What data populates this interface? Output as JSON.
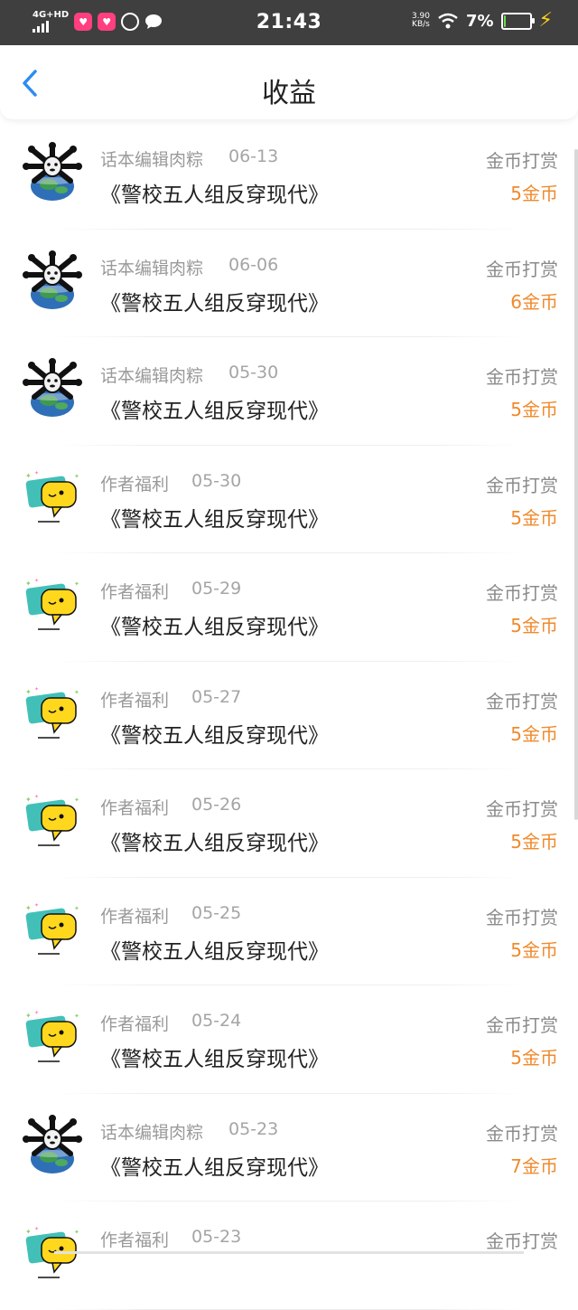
{
  "status_bar": {
    "network": "4G+HD",
    "time": "21:43",
    "speed_value": "3.90",
    "speed_unit": "KB/s",
    "battery_pct": "7%",
    "battery_level": 0.07
  },
  "header": {
    "title": "收益",
    "back_icon": "chevron-left-icon"
  },
  "colors": {
    "accent_blue": "#2d8cf0",
    "amount_orange": "#f08a2c"
  },
  "records": [
    {
      "avatar": "skull-globe-avatar",
      "source": "话本编辑肉粽",
      "date": "06-13",
      "title": "《警校五人组反穿现代》",
      "type": "金币打赏",
      "amount": "5金币"
    },
    {
      "avatar": "skull-globe-avatar",
      "source": "话本编辑肉粽",
      "date": "06-06",
      "title": "《警校五人组反穿现代》",
      "type": "金币打赏",
      "amount": "6金币"
    },
    {
      "avatar": "skull-globe-avatar",
      "source": "话本编辑肉粽",
      "date": "05-30",
      "title": "《警校五人组反穿现代》",
      "type": "金币打赏",
      "amount": "5金币"
    },
    {
      "avatar": "yellow-bubble-avatar",
      "source": "作者福利",
      "date": "05-30",
      "title": "《警校五人组反穿现代》",
      "type": "金币打赏",
      "amount": "5金币"
    },
    {
      "avatar": "yellow-bubble-avatar",
      "source": "作者福利",
      "date": "05-29",
      "title": "《警校五人组反穿现代》",
      "type": "金币打赏",
      "amount": "5金币"
    },
    {
      "avatar": "yellow-bubble-avatar",
      "source": "作者福利",
      "date": "05-27",
      "title": "《警校五人组反穿现代》",
      "type": "金币打赏",
      "amount": "5金币"
    },
    {
      "avatar": "yellow-bubble-avatar",
      "source": "作者福利",
      "date": "05-26",
      "title": "《警校五人组反穿现代》",
      "type": "金币打赏",
      "amount": "5金币"
    },
    {
      "avatar": "yellow-bubble-avatar",
      "source": "作者福利",
      "date": "05-25",
      "title": "《警校五人组反穿现代》",
      "type": "金币打赏",
      "amount": "5金币"
    },
    {
      "avatar": "yellow-bubble-avatar",
      "source": "作者福利",
      "date": "05-24",
      "title": "《警校五人组反穿现代》",
      "type": "金币打赏",
      "amount": "5金币"
    },
    {
      "avatar": "skull-globe-avatar",
      "source": "话本编辑肉粽",
      "date": "05-23",
      "title": "《警校五人组反穿现代》",
      "type": "金币打赏",
      "amount": "7金币"
    },
    {
      "avatar": "yellow-bubble-avatar",
      "source": "作者福利",
      "date": "05-23",
      "title": "",
      "type": "金币打赏",
      "amount": ""
    }
  ]
}
